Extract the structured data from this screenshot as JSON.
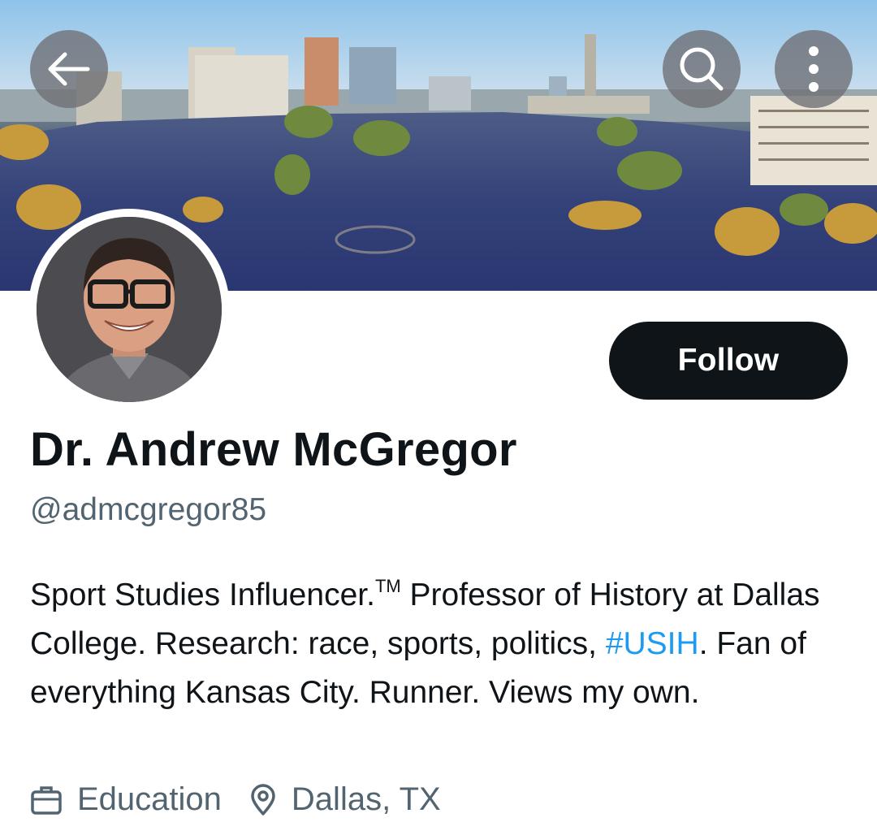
{
  "header": {
    "back_icon": "arrow-left-icon",
    "search_icon": "search-icon",
    "more_icon": "more-vertical-icon"
  },
  "profile": {
    "display_name": "Dr. Andrew McGregor",
    "handle": "@admcgregor85",
    "follow_label": "Follow",
    "bio": {
      "part1": "Sport Studies Influencer.",
      "tm": "TM",
      "part2": " Professor of History at Dallas College. Research: race, sports, politics, ",
      "hashtag": "#USIH",
      "part3": ". Fan of everything Kansas City. Runner. Views my own."
    },
    "category": "Education",
    "category_icon": "briefcase-icon",
    "location": "Dallas, TX",
    "location_icon": "location-pin-icon"
  },
  "colors": {
    "primary_text": "#0f1419",
    "secondary_text": "#536471",
    "link": "#1d9bf0",
    "follow_bg": "#0f1419"
  }
}
